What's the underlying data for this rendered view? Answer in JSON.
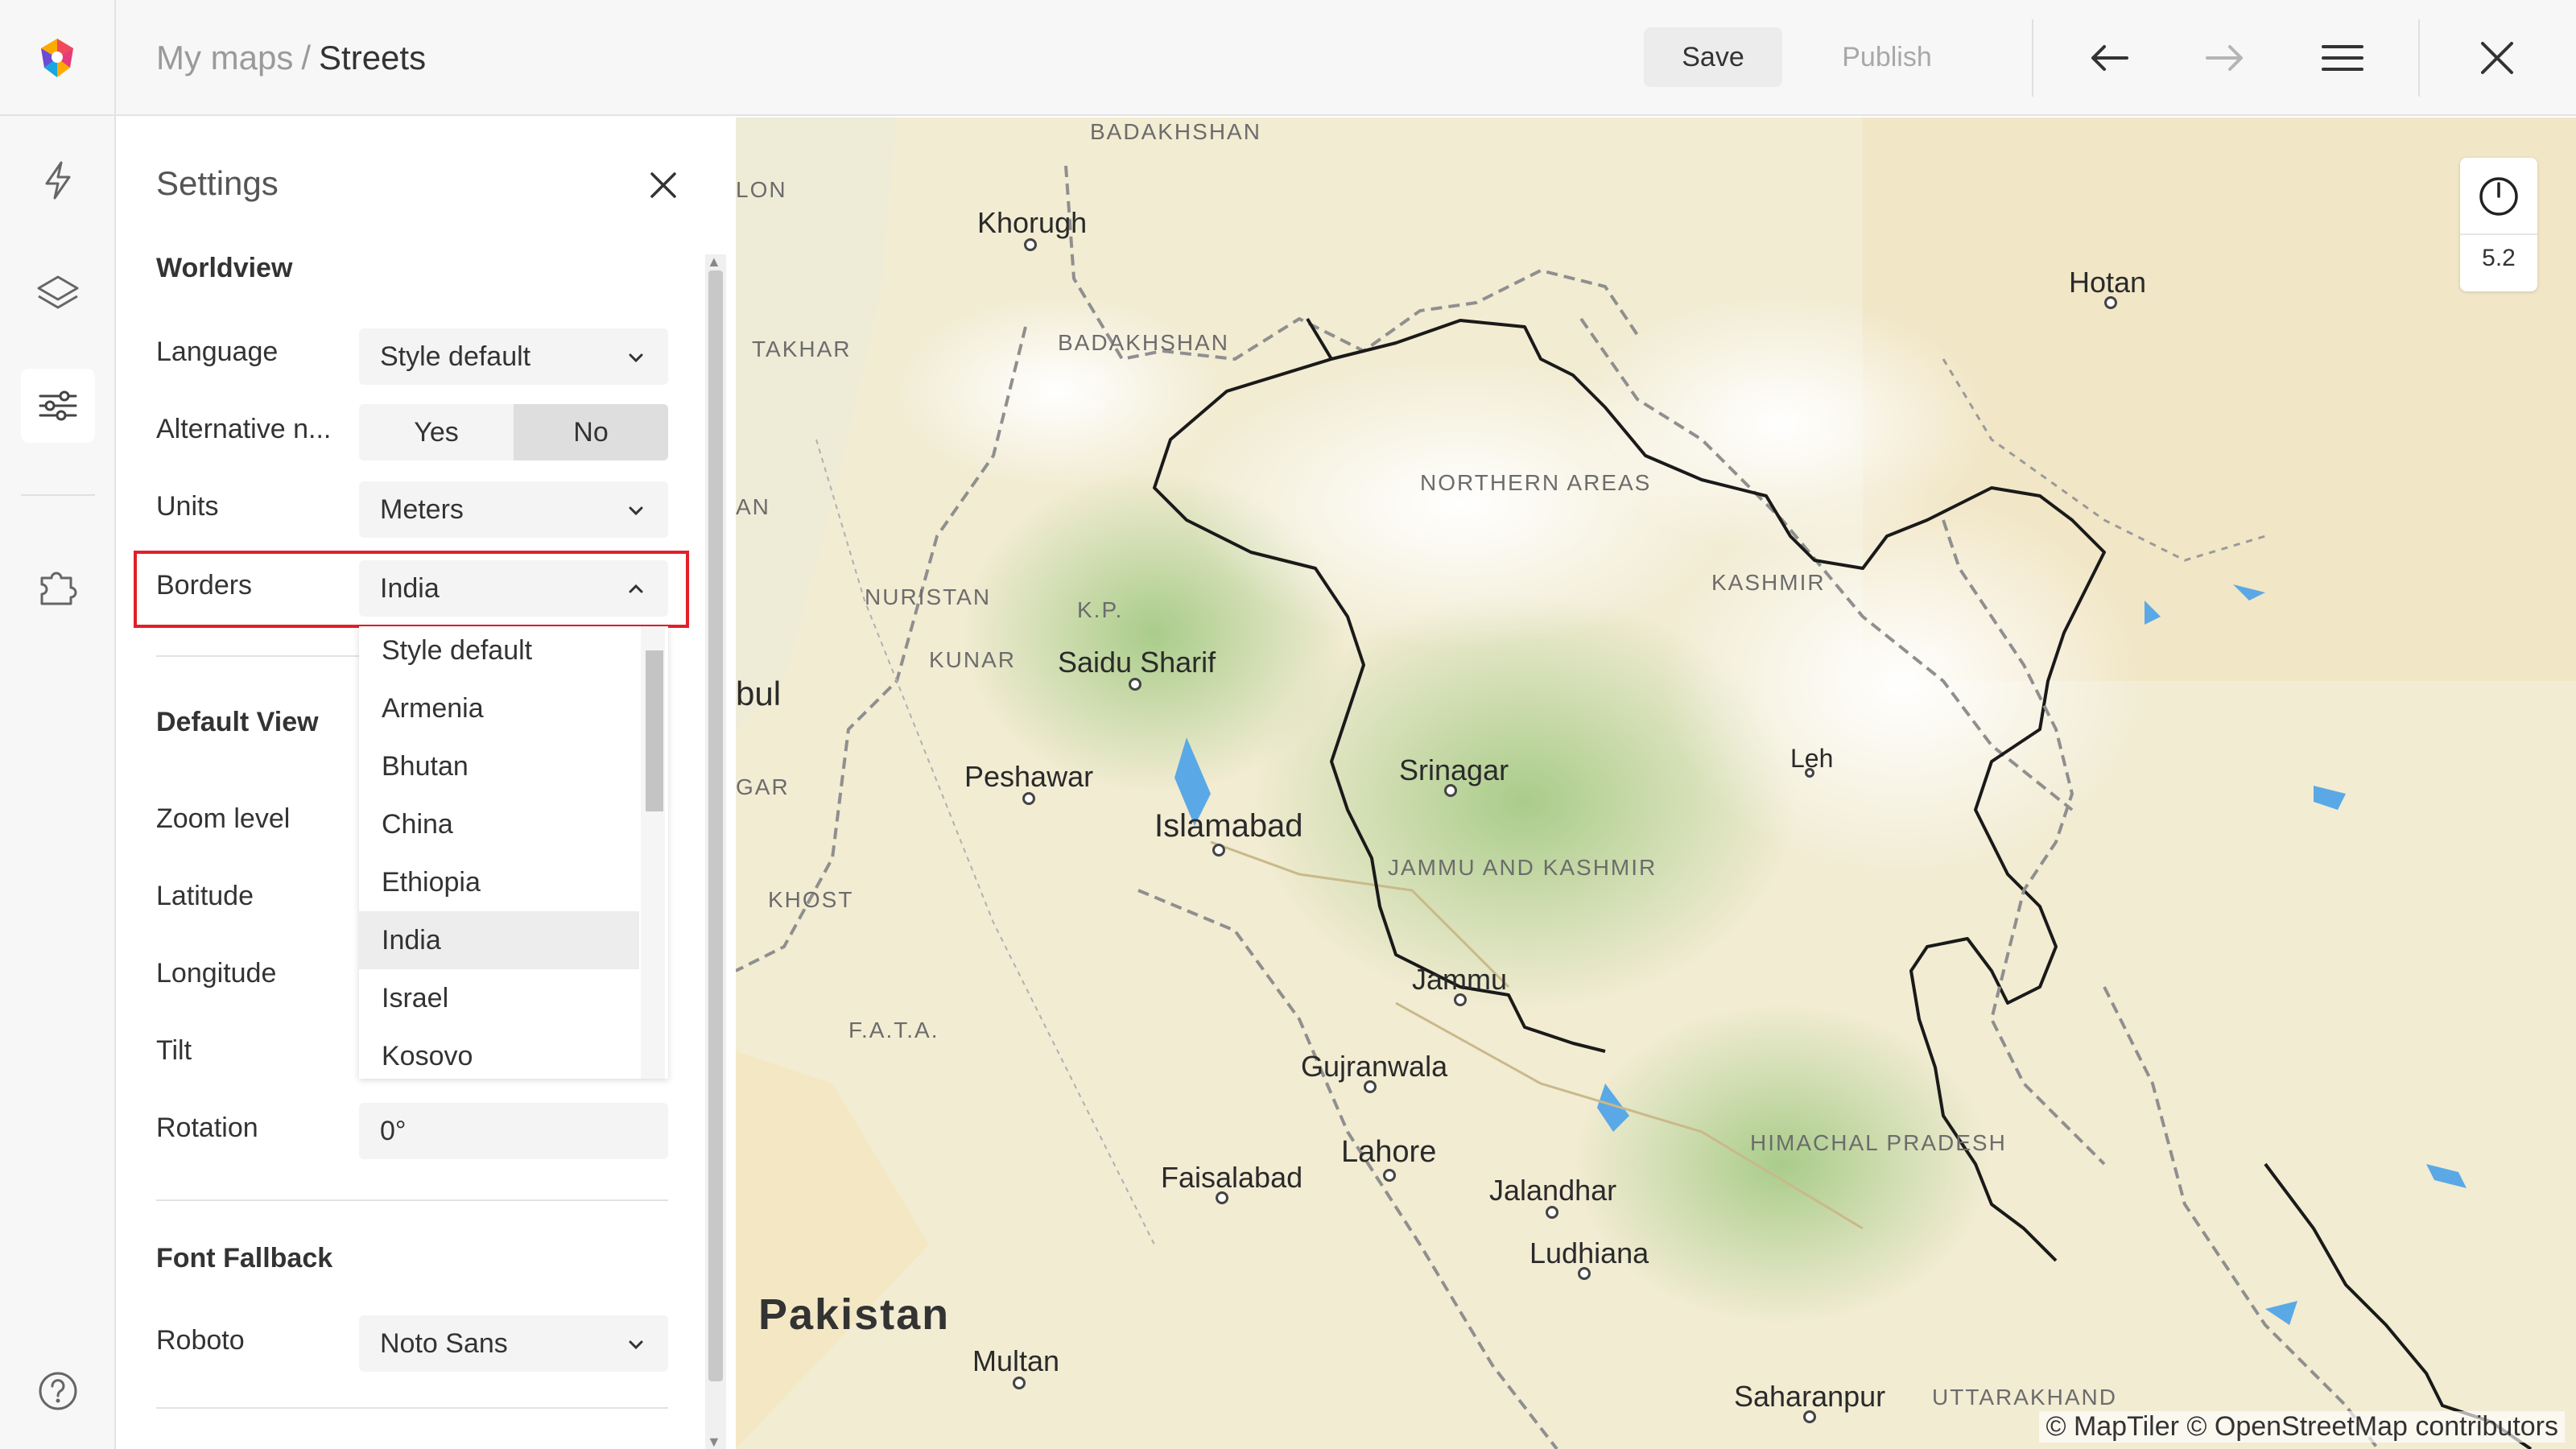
{
  "header": {
    "breadcrumb_parent": "My maps",
    "breadcrumb_sep": "/",
    "breadcrumb_current": "Streets",
    "save_label": "Save",
    "publish_label": "Publish"
  },
  "rail": {
    "icons": [
      "lightning-icon",
      "layers-icon",
      "sliders-icon",
      "puzzle-icon",
      "help-icon"
    ],
    "active": "sliders-icon"
  },
  "settings": {
    "title": "Settings",
    "worldview": {
      "title": "Worldview",
      "language_label": "Language",
      "language_value": "Style default",
      "altnames_label": "Alternative n...",
      "altnames_yes": "Yes",
      "altnames_no": "No",
      "altnames_selected": "No",
      "units_label": "Units",
      "units_value": "Meters",
      "borders_label": "Borders",
      "borders_value": "India"
    },
    "default_view": {
      "title": "Default View",
      "zoom_label": "Zoom level",
      "latitude_label": "Latitude",
      "longitude_label": "Longitude",
      "tilt_label": "Tilt",
      "rotation_label": "Rotation",
      "rotation_value": "0°"
    },
    "font_fallback": {
      "title": "Font Fallback",
      "roboto_label": "Roboto",
      "roboto_value": "Noto Sans"
    }
  },
  "borders_dropdown": {
    "options": [
      "Style default",
      "Armenia",
      "Bhutan",
      "China",
      "Ethiopia",
      "India",
      "Israel",
      "Kosovo"
    ],
    "selected": "India"
  },
  "map": {
    "zoom_value": "5.2",
    "attribution": "© MapTiler © OpenStreetMap contributors",
    "country_label": "Pakistan",
    "cities": [
      "Khorugh",
      "Hotan",
      "Saidu Sharif",
      "Peshawar",
      "Islamabad",
      "Srinagar",
      "Leh",
      "Jammu",
      "Gujranwala",
      "Lahore",
      "Faisalabad",
      "Jalandhar",
      "Ludhiana",
      "Multan",
      "Saharanpur"
    ],
    "regions": [
      "BADAKHSHAN",
      "BADAKHSHAN",
      "TAKHAR",
      "NORTHERN AREAS",
      "KASHMIR",
      "NURISTAN",
      "K.P.",
      "KUNAR",
      "JAMMU AND KASHMIR",
      "KHOST",
      "F.A.T.A.",
      "HIMACHAL PRADESH",
      "UTTARAKHAND",
      "LON",
      "AN",
      "GAR",
      "bul"
    ],
    "colors": {
      "land": "#f2ecd3",
      "forest": "#bcd79a",
      "mountain": "#ffffff",
      "water": "#5aa9e6",
      "border": "#1a1a1a"
    }
  }
}
